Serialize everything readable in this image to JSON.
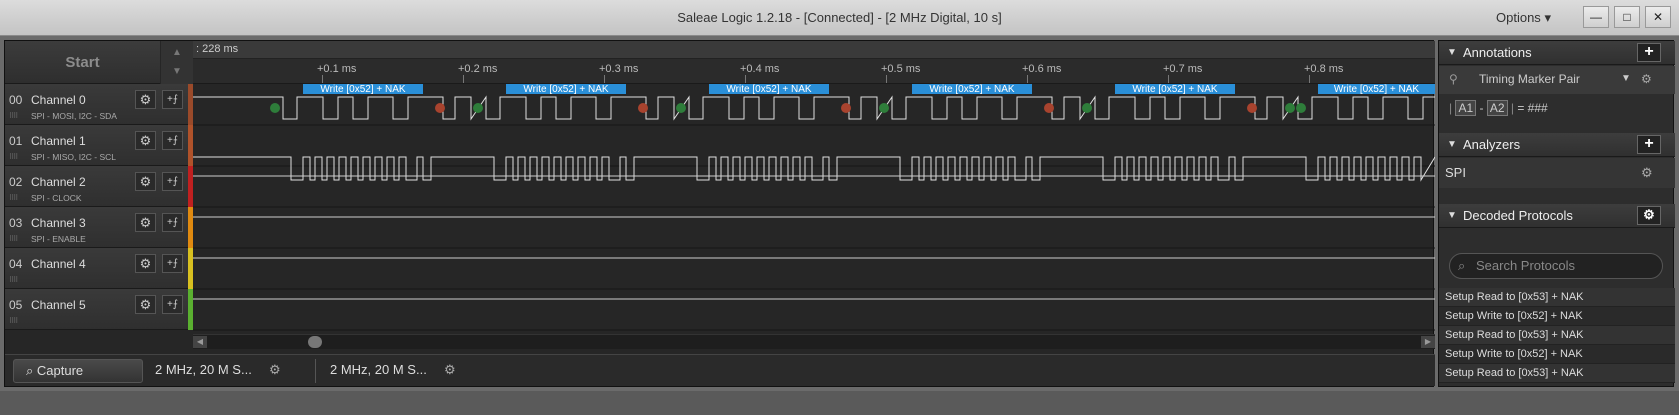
{
  "window": {
    "title": "Saleae Logic 1.2.18 - [Connected] - [2 MHz Digital, 10 s]",
    "options_label": "Options",
    "min_label": "—",
    "max_label": "□",
    "close_label": "✕"
  },
  "capture": {
    "start_label": "Start",
    "time_offset": ": 228 ms",
    "ruler_ticks": [
      "+0.1 ms",
      "+0.2 ms",
      "+0.3 ms",
      "+0.4 ms",
      "+0.5 ms",
      "+0.6 ms",
      "+0.7 ms",
      "+0.8 ms"
    ]
  },
  "channels": [
    {
      "num": "00",
      "name": "Channel 0",
      "sub": "SPI - MOSI, I2C - SDA",
      "color": "#9a4a2a"
    },
    {
      "num": "01",
      "name": "Channel 1",
      "sub": "SPI - MISO, I2C - SCL",
      "color": "#b0522a"
    },
    {
      "num": "02",
      "name": "Channel 2",
      "sub": "SPI - CLOCK",
      "color": "#c02020"
    },
    {
      "num": "03",
      "name": "Channel 3",
      "sub": "SPI - ENABLE",
      "color": "#e08a10"
    },
    {
      "num": "04",
      "name": "Channel 4",
      "sub": "",
      "color": "#d8c020"
    },
    {
      "num": "05",
      "name": "Channel 5",
      "sub": "",
      "color": "#5ab030"
    }
  ],
  "decoded_label": "Write [0x52] + NAK",
  "decoded_label_clipped": "Wr",
  "tabs": {
    "capture_label": "Capture",
    "session1_label": "2 MHz, 20 M S...",
    "session2_label": "2 MHz, 20 M S..."
  },
  "annotations": {
    "header": "Annotations",
    "marker": "Timing Marker Pair",
    "a1": "A1",
    "a2": "A2",
    "formula": "= ###",
    "sep": "-"
  },
  "analyzers": {
    "header": "Analyzers",
    "items": [
      "SPI"
    ]
  },
  "decoded_protocols": {
    "header": "Decoded Protocols",
    "search_placeholder": "Search Protocols",
    "rows": [
      "Setup Read to [0x53] + NAK",
      "Setup Write to [0x52] + NAK",
      "Setup Read to [0x53] + NAK",
      "Setup Write to [0x52] + NAK",
      "Setup Read to [0x53] + NAK"
    ]
  },
  "colors": {
    "accent_blue": "#2a8fd8",
    "green_dot": "#2e7d3a",
    "red_dot": "#a8432e"
  },
  "waveform_segments": [
    {
      "start_ms": 0.05,
      "period_ms": 0.145
    }
  ]
}
